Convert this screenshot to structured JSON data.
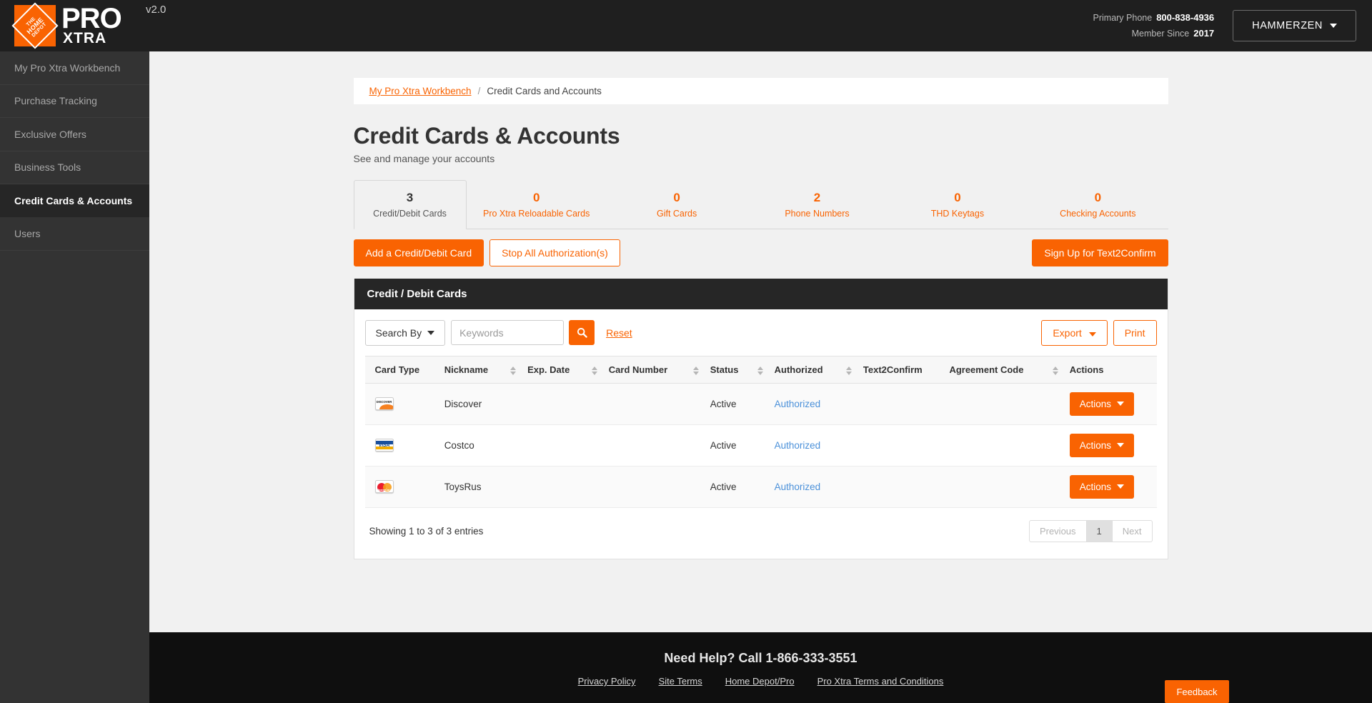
{
  "header": {
    "logo": {
      "brand": "THE HOME DEPOT",
      "pro": "PRO",
      "xtra": "XTRA",
      "version": "v2.0"
    },
    "primary_phone_label": "Primary Phone",
    "primary_phone_value": "800-838-4936",
    "member_since_label": "Member Since",
    "member_since_value": "2017",
    "user_button": "HAMMERZEN"
  },
  "sidebar": {
    "items": [
      {
        "label": "My Pro Xtra Workbench",
        "active": false
      },
      {
        "label": "Purchase Tracking",
        "active": false
      },
      {
        "label": "Exclusive Offers",
        "active": false
      },
      {
        "label": "Business Tools",
        "active": false
      },
      {
        "label": "Credit Cards & Accounts",
        "active": true
      },
      {
        "label": "Users",
        "active": false
      }
    ]
  },
  "breadcrumb": {
    "link": "My Pro Xtra Workbench",
    "separator": "/",
    "current": "Credit Cards and Accounts"
  },
  "page": {
    "title": "Credit Cards & Accounts",
    "subtitle": "See and manage your accounts"
  },
  "tabs": [
    {
      "count": "3",
      "label": "Credit/Debit Cards",
      "active": true
    },
    {
      "count": "0",
      "label": "Pro Xtra Reloadable Cards",
      "active": false
    },
    {
      "count": "0",
      "label": "Gift Cards",
      "active": false
    },
    {
      "count": "2",
      "label": "Phone Numbers",
      "active": false
    },
    {
      "count": "0",
      "label": "THD Keytags",
      "active": false
    },
    {
      "count": "0",
      "label": "Checking Accounts",
      "active": false
    }
  ],
  "actions": {
    "add_card": "Add a Credit/Debit Card",
    "stop_auth": "Stop All Authorization(s)",
    "text2confirm": "Sign Up for Text2Confirm"
  },
  "panel": {
    "title": "Credit / Debit Cards",
    "search_by": "Search By",
    "keywords_placeholder": "Keywords",
    "reset": "Reset",
    "export": "Export",
    "print": "Print",
    "columns": [
      {
        "label": "Card Type",
        "sortable": false
      },
      {
        "label": "Nickname",
        "sortable": true
      },
      {
        "label": "Exp. Date",
        "sortable": true
      },
      {
        "label": "Card Number",
        "sortable": true
      },
      {
        "label": "Status",
        "sortable": true
      },
      {
        "label": "Authorized",
        "sortable": true
      },
      {
        "label": "Text2Confirm",
        "sortable": false
      },
      {
        "label": "Agreement Code",
        "sortable": true
      },
      {
        "label": "Actions",
        "sortable": false
      }
    ],
    "rows": [
      {
        "card_type": "discover",
        "nickname": "Discover",
        "exp_date": "",
        "card_number": "",
        "status": "Active",
        "authorized": "Authorized",
        "text2confirm": "",
        "agreement_code": "",
        "action_label": "Actions"
      },
      {
        "card_type": "visa",
        "nickname": "Costco",
        "exp_date": "",
        "card_number": "",
        "status": "Active",
        "authorized": "Authorized",
        "text2confirm": "",
        "agreement_code": "",
        "action_label": "Actions"
      },
      {
        "card_type": "mastercard",
        "nickname": "ToysRus",
        "exp_date": "",
        "card_number": "",
        "status": "Active",
        "authorized": "Authorized",
        "text2confirm": "",
        "agreement_code": "",
        "action_label": "Actions"
      }
    ],
    "showing": "Showing 1 to 3 of 3 entries",
    "pagination": {
      "previous": "Previous",
      "current": "1",
      "next": "Next"
    }
  },
  "footer": {
    "need_help": "Need Help? Call 1-866-333-3551",
    "links": [
      "Privacy Policy",
      "Site Terms",
      "Home Depot/Pro",
      "Pro Xtra Terms and Conditions"
    ]
  },
  "feedback": {
    "label": "Feedback"
  },
  "colors": {
    "brand_orange": "#f96302",
    "dark_bar": "#1f1f1f",
    "sidebar": "#333333",
    "panel_head": "#262626",
    "link_blue": "#4a90d9"
  }
}
